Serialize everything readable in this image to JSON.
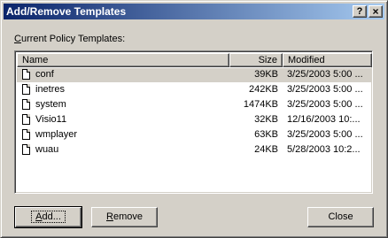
{
  "window": {
    "title": "Add/Remove Templates",
    "help_glyph": "?",
    "close_glyph": "×"
  },
  "label": {
    "prefix": "C",
    "rest": "urrent Policy Templates:"
  },
  "columns": {
    "name": "Name",
    "size": "Size",
    "modified": "Modified"
  },
  "rows": [
    {
      "name": "conf",
      "size": "39KB",
      "modified": "3/25/2003 5:00 ..."
    },
    {
      "name": "inetres",
      "size": "242KB",
      "modified": "3/25/2003 5:00 ..."
    },
    {
      "name": "system",
      "size": "1474KB",
      "modified": "3/25/2003 5:00 ..."
    },
    {
      "name": "Visio11",
      "size": "32KB",
      "modified": "12/16/2003 10:..."
    },
    {
      "name": "wmplayer",
      "size": "63KB",
      "modified": "3/25/2003 5:00 ..."
    },
    {
      "name": "wuau",
      "size": "24KB",
      "modified": "5/28/2003 10:2..."
    }
  ],
  "buttons": {
    "add": {
      "prefix": "A",
      "rest": "dd..."
    },
    "remove": {
      "prefix": "R",
      "rest": "emove"
    },
    "close": {
      "label": "Close"
    }
  },
  "colors": {
    "title_gradient_start": "#0a246a",
    "title_gradient_end": "#a6caf0",
    "face": "#d4d0c8"
  }
}
